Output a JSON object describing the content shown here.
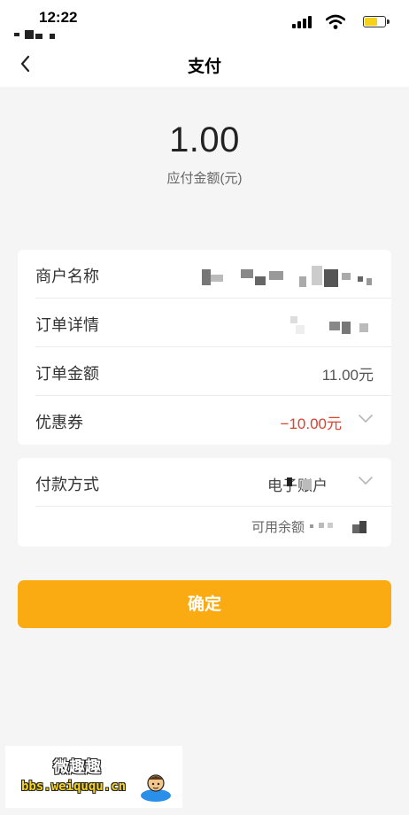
{
  "status_bar": {
    "time": "12:22",
    "battery_color": "#f7d21b"
  },
  "nav": {
    "title": "支付",
    "back_icon": "chevron-left-icon"
  },
  "payment": {
    "amount": "1.00",
    "caption": "应付金额(元)"
  },
  "order_info": {
    "merchant_label": "商户名称",
    "order_detail_label": "订单详情",
    "order_amount_label": "订单金额",
    "order_amount_value": "11.00元",
    "coupon_label": "优惠券",
    "coupon_value": "−10.00元",
    "coupon_color": "#d8422f"
  },
  "payment_method": {
    "label": "付款方式",
    "value": "电子账户",
    "balance_label": "可用余额"
  },
  "confirm": {
    "label": "确定",
    "color": "#fbab12"
  },
  "watermark": {
    "title": "微趣趣",
    "url": "bbs.weiququ.cn"
  }
}
